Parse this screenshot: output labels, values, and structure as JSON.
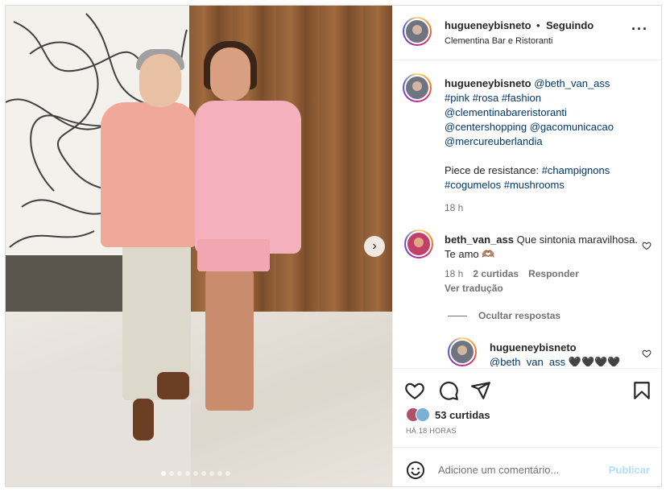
{
  "header": {
    "username": "hugueneybisneto",
    "separator": "•",
    "follow_status": "Seguindo",
    "location": "Clementina Bar e Ristoranti",
    "more_icon": "more-horizontal-icon"
  },
  "caption": {
    "username": "hugueneybisneto",
    "line1_mention": "@beth_van_ass",
    "tags_line": "#pink #rosa #fashion",
    "mention2": "@clementinabareristoranti",
    "mention3": "@centershopping @gacomunicacao",
    "mention4": "@mercureuberlandia",
    "piece_text": "Piece de resistance: ",
    "piece_tags": "#champignons",
    "piece_tags2": "#cogumelos #mushrooms",
    "time": "18 h"
  },
  "comment": {
    "username": "beth_van_ass",
    "text": "Que sintonia maravilhosa. Te amo 🫶🏽",
    "time": "18 h",
    "likes": "2 curtidas",
    "reply": "Responder",
    "translate": "Ver tradução",
    "hide_replies": "Ocultar respostas"
  },
  "reply": {
    "username": "hugueneybisneto",
    "mention": "@beth_van_ass",
    "text": " 🖤🖤🖤🖤"
  },
  "actions": {
    "likes": "53 curtidas",
    "ago": "HÁ 18 HORAS"
  },
  "add_comment": {
    "placeholder": "Adicione um comentário...",
    "publish": "Publicar"
  },
  "carousel": {
    "slide_count": 9,
    "active_index": 0
  },
  "colors": {
    "link": "#00376b",
    "muted": "#737373",
    "publish_disabled": "#b2dffc"
  }
}
